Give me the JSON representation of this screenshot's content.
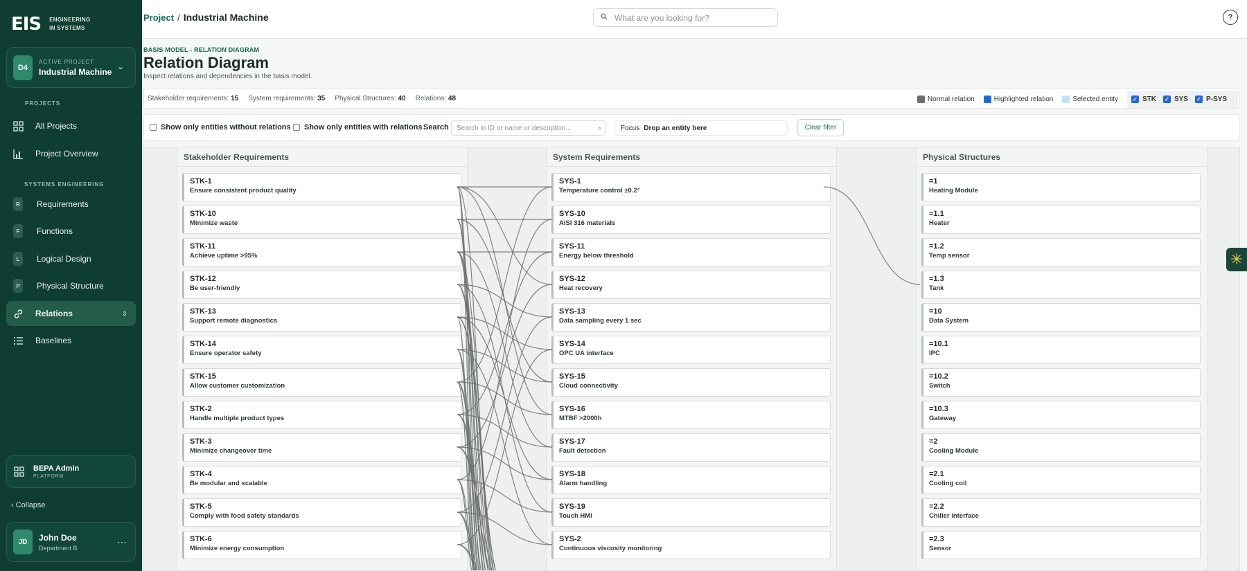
{
  "brand": {
    "mark": "EIS",
    "line1": "ENGINEERING",
    "line2": "IN SYSTEMS"
  },
  "project": {
    "badge": "D4",
    "label": "ACTIVE PROJECT",
    "name": "Industrial Machine"
  },
  "sidebar": {
    "projects_label": "PROJECTS",
    "systems_label": "SYSTEMS ENGINEERING",
    "items": [
      {
        "label": "All Projects",
        "icon": "grid-icon"
      },
      {
        "label": "Project Overview",
        "icon": "bar-chart-icon"
      },
      {
        "label": "Requirements",
        "letter": "R"
      },
      {
        "label": "Functions",
        "letter": "F"
      },
      {
        "label": "Logical Design",
        "letter": "L"
      },
      {
        "label": "Physical Structure",
        "letter": "P"
      },
      {
        "label": "Relations",
        "icon": "link-icon",
        "count": "3",
        "active": true
      },
      {
        "label": "Baselines",
        "icon": "list-icon"
      }
    ],
    "admin": {
      "name": "BEPA Admin",
      "sub": "PLATFORM"
    },
    "collapse": "Collapse",
    "user": {
      "initials": "JD",
      "name": "John Doe",
      "dept": "Department B"
    }
  },
  "topbar": {
    "crumb_root": "Project",
    "crumb_sep": "/",
    "crumb_current": "Industrial Machine",
    "search_placeholder": "What are you looking for?"
  },
  "header": {
    "subtitle": "BASIS MODEL - RELATION DIAGRAM",
    "title": "Relation Diagram",
    "description": "Inspect relations and dependencies in the basis model."
  },
  "stats": {
    "stk_label": "Stakeholder requirements:",
    "stk_value": "15",
    "sys_label": "System requirements:",
    "sys_value": "35",
    "ps_label": "Physical Structures:",
    "ps_value": "40",
    "rel_label": "Relations:",
    "rel_value": "48"
  },
  "legend": {
    "normal": "Normal relation",
    "normal_color": "#6b6f6e",
    "highlighted": "Highlighted relation",
    "highlighted_color": "#1f6bd6",
    "selected": "Selected entity",
    "selected_color": "#bfe3f5",
    "toggles": [
      "STK",
      "SYS",
      "P-SYS"
    ]
  },
  "filters": {
    "without_label": "Show only entities without relations",
    "with_label": "Show only entities with relations",
    "search_label": "Search",
    "search_placeholder": "Search in ID or name or description...",
    "focus_label": "Focus",
    "focus_value": "Drop an entity here",
    "clear_label": "Clear filter"
  },
  "columns": {
    "stk_title": "Stakeholder Requirements",
    "sys_title": "System Requirements",
    "ps_title": "Physical Structures"
  },
  "stk": [
    {
      "id": "STK-1",
      "name": "Ensure consistent product quality"
    },
    {
      "id": "STK-10",
      "name": "Minimize waste"
    },
    {
      "id": "STK-11",
      "name": "Achieve uptime >95%"
    },
    {
      "id": "STK-12",
      "name": "Be user-friendly"
    },
    {
      "id": "STK-13",
      "name": "Support remote diagnostics"
    },
    {
      "id": "STK-14",
      "name": "Ensure operator safety"
    },
    {
      "id": "STK-15",
      "name": "Allow customer customization"
    },
    {
      "id": "STK-2",
      "name": "Handle multiple product types"
    },
    {
      "id": "STK-3",
      "name": "Minimize changeover time"
    },
    {
      "id": "STK-4",
      "name": "Be modular and scalable"
    },
    {
      "id": "STK-5",
      "name": "Comply with food safety standards"
    },
    {
      "id": "STK-6",
      "name": "Minimize energy consumption"
    }
  ],
  "sys": [
    {
      "id": "SYS-1",
      "name": "Temperature control ±0.2°"
    },
    {
      "id": "SYS-10",
      "name": "AISI 316 materials"
    },
    {
      "id": "SYS-11",
      "name": "Energy below threshold"
    },
    {
      "id": "SYS-12",
      "name": "Heat recovery"
    },
    {
      "id": "SYS-13",
      "name": "Data sampling every 1 sec"
    },
    {
      "id": "SYS-14",
      "name": "OPC UA interface"
    },
    {
      "id": "SYS-15",
      "name": "Cloud connectivity"
    },
    {
      "id": "SYS-16",
      "name": "MTBF >2000h"
    },
    {
      "id": "SYS-17",
      "name": "Fault detection"
    },
    {
      "id": "SYS-18",
      "name": "Alarm handling"
    },
    {
      "id": "SYS-19",
      "name": "Touch HMI"
    },
    {
      "id": "SYS-2",
      "name": "Continuous viscosity monitoring"
    }
  ],
  "ps": [
    {
      "id": "=1",
      "name": "Heating Module"
    },
    {
      "id": "=1.1",
      "name": "Heater"
    },
    {
      "id": "=1.2",
      "name": "Temp sensor"
    },
    {
      "id": "=1.3",
      "name": "Tank"
    },
    {
      "id": "=10",
      "name": "Data System"
    },
    {
      "id": "=10.1",
      "name": "IPC"
    },
    {
      "id": "=10.2",
      "name": "Switch"
    },
    {
      "id": "=10.3",
      "name": "Gateway"
    },
    {
      "id": "=2",
      "name": "Cooling Module"
    },
    {
      "id": "=2.1",
      "name": "Cooling coil"
    },
    {
      "id": "=2.2",
      "name": "Chiller interface"
    },
    {
      "id": "=2.3",
      "name": "Sensor"
    }
  ],
  "links_stk_sys": [
    [
      0,
      0
    ],
    [
      0,
      3
    ],
    [
      0,
      7
    ],
    [
      1,
      1
    ],
    [
      1,
      6
    ],
    [
      2,
      2
    ],
    [
      2,
      8
    ],
    [
      3,
      4
    ],
    [
      3,
      10
    ],
    [
      4,
      5
    ],
    [
      4,
      9
    ],
    [
      5,
      6
    ],
    [
      5,
      11
    ],
    [
      6,
      0
    ],
    [
      6,
      7
    ],
    [
      7,
      2
    ],
    [
      7,
      8
    ],
    [
      8,
      3
    ],
    [
      8,
      9
    ],
    [
      9,
      1
    ],
    [
      9,
      10
    ],
    [
      10,
      4
    ],
    [
      10,
      11
    ],
    [
      11,
      5
    ]
  ],
  "links_down": [
    0,
    0,
    1,
    1,
    2,
    2,
    3,
    3,
    4,
    4,
    5,
    5,
    6,
    6,
    7,
    7,
    8,
    8,
    9,
    9,
    10,
    10,
    11,
    11,
    0,
    2,
    4,
    6
  ],
  "links_sys_ps": [
    [
      0,
      3
    ]
  ]
}
